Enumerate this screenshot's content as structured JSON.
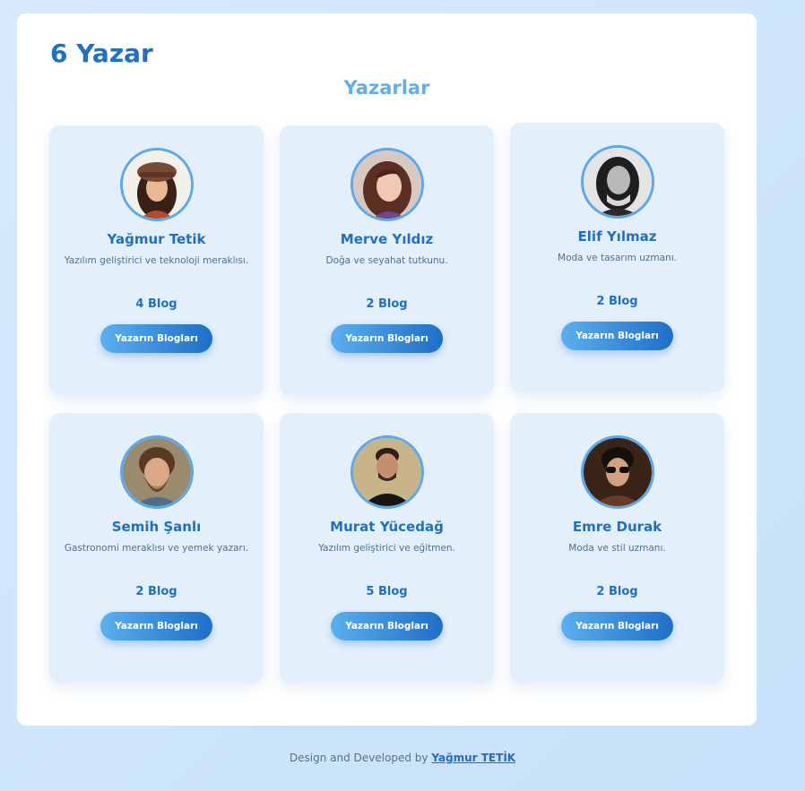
{
  "header": {
    "count_title": "6 Yazar",
    "section_title": "Yazarlar"
  },
  "authors": [
    {
      "name": "Yağmur Tetik",
      "bio": "Yazılım geliştirici ve teknoloji meraklısı.",
      "blogs": "4 Blog",
      "button": "Yazarın Blogları"
    },
    {
      "name": "Merve Yıldız",
      "bio": "Doğa ve seyahat tutkunu.",
      "blogs": "2 Blog",
      "button": "Yazarın Blogları"
    },
    {
      "name": "Elif Yılmaz",
      "bio": "Moda ve tasarım uzmanı.",
      "blogs": "2 Blog",
      "button": "Yazarın Blogları"
    },
    {
      "name": "Semih Şanlı",
      "bio": "Gastronomi meraklısı ve yemek yazarı.",
      "blogs": "2 Blog",
      "button": "Yazarın Blogları"
    },
    {
      "name": "Murat Yücedağ",
      "bio": "Yazılım geliştirici ve eğitmen.",
      "blogs": "5 Blog",
      "button": "Yazarın Blogları"
    },
    {
      "name": "Emre Durak",
      "bio": "Moda ve stil uzmanı.",
      "blogs": "2 Blog",
      "button": "Yazarın Blogları"
    }
  ],
  "footer": {
    "text": "Design and Developed by",
    "author_link": "Yağmur TETİK"
  },
  "colors": {
    "accent": "#1f6fc4",
    "card_bg": "#e3f0fc",
    "title_light": "#63aee9",
    "page_bg": "#c6e1fa"
  }
}
